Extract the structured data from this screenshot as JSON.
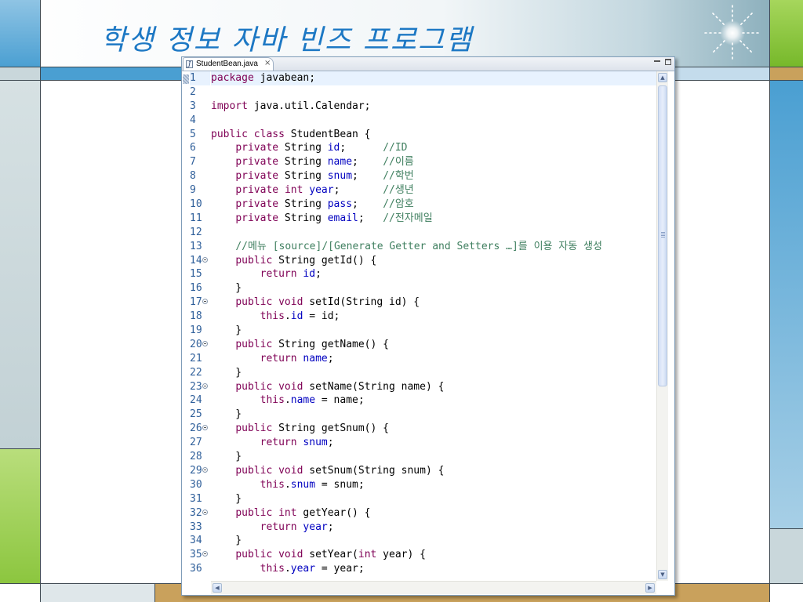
{
  "slide": {
    "title": "학생 정보 자바 빈즈 프로그램",
    "colors": {
      "title": "#1d78c4",
      "deco_blue": "#4a9fd2",
      "deco_green": "#8cc63f",
      "deco_tan": "#c9a15c",
      "deco_grey": "#c9d7db"
    }
  },
  "editor": {
    "tab": {
      "icon": "java-file-icon",
      "label": "StudentBean.java",
      "close_glyph": "×"
    },
    "window_controls": [
      "minimize-icon",
      "maximize-icon"
    ],
    "current_line": 1,
    "scrollbar": {
      "vertical_position": 0.0,
      "visible_fraction": 0.6
    },
    "syntax_colors": {
      "keyword": "#7f0055",
      "field": "#0000c0",
      "comment": "#3f7f5f",
      "plain": "#000000"
    },
    "lines": [
      {
        "n": "1",
        "fold": false,
        "tokens": [
          [
            "kw",
            "package"
          ],
          [
            "plain",
            " javabean;"
          ]
        ]
      },
      {
        "n": "2",
        "fold": false,
        "tokens": []
      },
      {
        "n": "3",
        "fold": false,
        "tokens": [
          [
            "kw",
            "import"
          ],
          [
            "plain",
            " java.util.Calendar;"
          ]
        ]
      },
      {
        "n": "4",
        "fold": false,
        "tokens": []
      },
      {
        "n": "5",
        "fold": false,
        "tokens": [
          [
            "kw",
            "public"
          ],
          [
            "plain",
            " "
          ],
          [
            "kw",
            "class"
          ],
          [
            "plain",
            " StudentBean {"
          ]
        ]
      },
      {
        "n": "6",
        "fold": false,
        "tokens": [
          [
            "plain",
            "    "
          ],
          [
            "kw",
            "private"
          ],
          [
            "plain",
            " String "
          ],
          [
            "field",
            "id"
          ],
          [
            "plain",
            ";      "
          ],
          [
            "cmt",
            "//ID"
          ]
        ]
      },
      {
        "n": "7",
        "fold": false,
        "tokens": [
          [
            "plain",
            "    "
          ],
          [
            "kw",
            "private"
          ],
          [
            "plain",
            " String "
          ],
          [
            "field",
            "name"
          ],
          [
            "plain",
            ";    "
          ],
          [
            "cmt",
            "//이름"
          ]
        ]
      },
      {
        "n": "8",
        "fold": false,
        "tokens": [
          [
            "plain",
            "    "
          ],
          [
            "kw",
            "private"
          ],
          [
            "plain",
            " String "
          ],
          [
            "field",
            "snum"
          ],
          [
            "plain",
            ";    "
          ],
          [
            "cmt",
            "//학번"
          ]
        ]
      },
      {
        "n": "9",
        "fold": false,
        "tokens": [
          [
            "plain",
            "    "
          ],
          [
            "kw",
            "private"
          ],
          [
            "plain",
            " "
          ],
          [
            "kw",
            "int"
          ],
          [
            "plain",
            " "
          ],
          [
            "field",
            "year"
          ],
          [
            "plain",
            ";       "
          ],
          [
            "cmt",
            "//생년"
          ]
        ]
      },
      {
        "n": "10",
        "fold": false,
        "tokens": [
          [
            "plain",
            "    "
          ],
          [
            "kw",
            "private"
          ],
          [
            "plain",
            " String "
          ],
          [
            "field",
            "pass"
          ],
          [
            "plain",
            ";    "
          ],
          [
            "cmt",
            "//암호"
          ]
        ]
      },
      {
        "n": "11",
        "fold": false,
        "tokens": [
          [
            "plain",
            "    "
          ],
          [
            "kw",
            "private"
          ],
          [
            "plain",
            " String "
          ],
          [
            "field",
            "email"
          ],
          [
            "plain",
            ";   "
          ],
          [
            "cmt",
            "//전자메일"
          ]
        ]
      },
      {
        "n": "12",
        "fold": false,
        "tokens": []
      },
      {
        "n": "13",
        "fold": false,
        "tokens": [
          [
            "plain",
            "    "
          ],
          [
            "cmt",
            "//메뉴 [source]/[Generate Getter and Setters …]를 이용 자동 생성"
          ]
        ]
      },
      {
        "n": "14",
        "fold": true,
        "tokens": [
          [
            "plain",
            "    "
          ],
          [
            "kw",
            "public"
          ],
          [
            "plain",
            " String getId() {"
          ]
        ]
      },
      {
        "n": "15",
        "fold": false,
        "tokens": [
          [
            "plain",
            "        "
          ],
          [
            "kw",
            "return"
          ],
          [
            "plain",
            " "
          ],
          [
            "field",
            "id"
          ],
          [
            "plain",
            ";"
          ]
        ]
      },
      {
        "n": "16",
        "fold": false,
        "tokens": [
          [
            "plain",
            "    }"
          ]
        ]
      },
      {
        "n": "17",
        "fold": true,
        "tokens": [
          [
            "plain",
            "    "
          ],
          [
            "kw",
            "public"
          ],
          [
            "plain",
            " "
          ],
          [
            "kw",
            "void"
          ],
          [
            "plain",
            " setId(String id) {"
          ]
        ]
      },
      {
        "n": "18",
        "fold": false,
        "tokens": [
          [
            "plain",
            "        "
          ],
          [
            "kw",
            "this"
          ],
          [
            "plain",
            "."
          ],
          [
            "field",
            "id"
          ],
          [
            "plain",
            " = id;"
          ]
        ]
      },
      {
        "n": "19",
        "fold": false,
        "tokens": [
          [
            "plain",
            "    }"
          ]
        ]
      },
      {
        "n": "20",
        "fold": true,
        "tokens": [
          [
            "plain",
            "    "
          ],
          [
            "kw",
            "public"
          ],
          [
            "plain",
            " String getName() {"
          ]
        ]
      },
      {
        "n": "21",
        "fold": false,
        "tokens": [
          [
            "plain",
            "        "
          ],
          [
            "kw",
            "return"
          ],
          [
            "plain",
            " "
          ],
          [
            "field",
            "name"
          ],
          [
            "plain",
            ";"
          ]
        ]
      },
      {
        "n": "22",
        "fold": false,
        "tokens": [
          [
            "plain",
            "    }"
          ]
        ]
      },
      {
        "n": "23",
        "fold": true,
        "tokens": [
          [
            "plain",
            "    "
          ],
          [
            "kw",
            "public"
          ],
          [
            "plain",
            " "
          ],
          [
            "kw",
            "void"
          ],
          [
            "plain",
            " setName(String name) {"
          ]
        ]
      },
      {
        "n": "24",
        "fold": false,
        "tokens": [
          [
            "plain",
            "        "
          ],
          [
            "kw",
            "this"
          ],
          [
            "plain",
            "."
          ],
          [
            "field",
            "name"
          ],
          [
            "plain",
            " = name;"
          ]
        ]
      },
      {
        "n": "25",
        "fold": false,
        "tokens": [
          [
            "plain",
            "    }"
          ]
        ]
      },
      {
        "n": "26",
        "fold": true,
        "tokens": [
          [
            "plain",
            "    "
          ],
          [
            "kw",
            "public"
          ],
          [
            "plain",
            " String getSnum() {"
          ]
        ]
      },
      {
        "n": "27",
        "fold": false,
        "tokens": [
          [
            "plain",
            "        "
          ],
          [
            "kw",
            "return"
          ],
          [
            "plain",
            " "
          ],
          [
            "field",
            "snum"
          ],
          [
            "plain",
            ";"
          ]
        ]
      },
      {
        "n": "28",
        "fold": false,
        "tokens": [
          [
            "plain",
            "    }"
          ]
        ]
      },
      {
        "n": "29",
        "fold": true,
        "tokens": [
          [
            "plain",
            "    "
          ],
          [
            "kw",
            "public"
          ],
          [
            "plain",
            " "
          ],
          [
            "kw",
            "void"
          ],
          [
            "plain",
            " setSnum(String snum) {"
          ]
        ]
      },
      {
        "n": "30",
        "fold": false,
        "tokens": [
          [
            "plain",
            "        "
          ],
          [
            "kw",
            "this"
          ],
          [
            "plain",
            "."
          ],
          [
            "field",
            "snum"
          ],
          [
            "plain",
            " = snum;"
          ]
        ]
      },
      {
        "n": "31",
        "fold": false,
        "tokens": [
          [
            "plain",
            "    }"
          ]
        ]
      },
      {
        "n": "32",
        "fold": true,
        "tokens": [
          [
            "plain",
            "    "
          ],
          [
            "kw",
            "public"
          ],
          [
            "plain",
            " "
          ],
          [
            "kw",
            "int"
          ],
          [
            "plain",
            " getYear() {"
          ]
        ]
      },
      {
        "n": "33",
        "fold": false,
        "tokens": [
          [
            "plain",
            "        "
          ],
          [
            "kw",
            "return"
          ],
          [
            "plain",
            " "
          ],
          [
            "field",
            "year"
          ],
          [
            "plain",
            ";"
          ]
        ]
      },
      {
        "n": "34",
        "fold": false,
        "tokens": [
          [
            "plain",
            "    }"
          ]
        ]
      },
      {
        "n": "35",
        "fold": true,
        "tokens": [
          [
            "plain",
            "    "
          ],
          [
            "kw",
            "public"
          ],
          [
            "plain",
            " "
          ],
          [
            "kw",
            "void"
          ],
          [
            "plain",
            " setYear("
          ],
          [
            "kw",
            "int"
          ],
          [
            "plain",
            " year) {"
          ]
        ]
      },
      {
        "n": "36",
        "fold": false,
        "tokens": [
          [
            "plain",
            "        "
          ],
          [
            "kw",
            "this"
          ],
          [
            "plain",
            "."
          ],
          [
            "field",
            "year"
          ],
          [
            "plain",
            " = year;"
          ]
        ]
      }
    ]
  }
}
